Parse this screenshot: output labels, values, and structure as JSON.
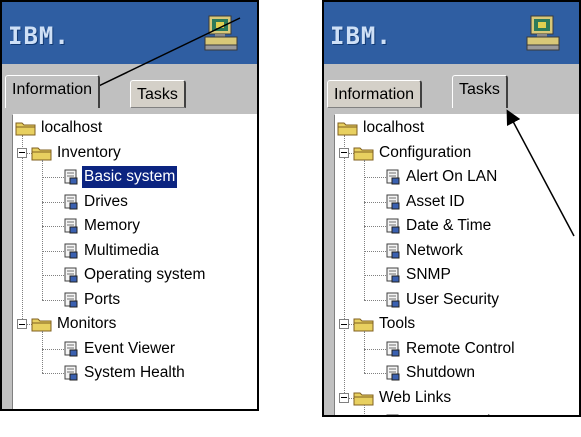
{
  "left": {
    "logo": "IBM.",
    "tabs": [
      "Information",
      "Tasks"
    ],
    "active_tab": "Information",
    "root": "localhost",
    "groups": [
      {
        "label": "Inventory",
        "items": [
          "Basic system",
          "Drives",
          "Memory",
          "Multimedia",
          "Operating system",
          "Ports"
        ]
      },
      {
        "label": "Monitors",
        "items": [
          "Event Viewer",
          "System Health"
        ]
      }
    ],
    "selected_item": "Basic system"
  },
  "right": {
    "logo": "IBM.",
    "tabs": [
      "Information",
      "Tasks"
    ],
    "active_tab": "Tasks",
    "root": "localhost",
    "groups": [
      {
        "label": "Configuration",
        "items": [
          "Alert On LAN",
          "Asset ID",
          "Date & Time",
          "Network",
          "SNMP",
          "User Security"
        ]
      },
      {
        "label": "Tools",
        "items": [
          "Remote Control",
          "Shutdown"
        ]
      },
      {
        "label": "Web Links",
        "items": [
          "System Updates"
        ]
      }
    ]
  },
  "colors": {
    "banner": "#2f5ea2",
    "selection": "#0b2480",
    "panel": "#c0c0c0"
  },
  "icons": {
    "computer": "computer-icon",
    "folder": "folder-icon",
    "leaf": "document-icon"
  }
}
